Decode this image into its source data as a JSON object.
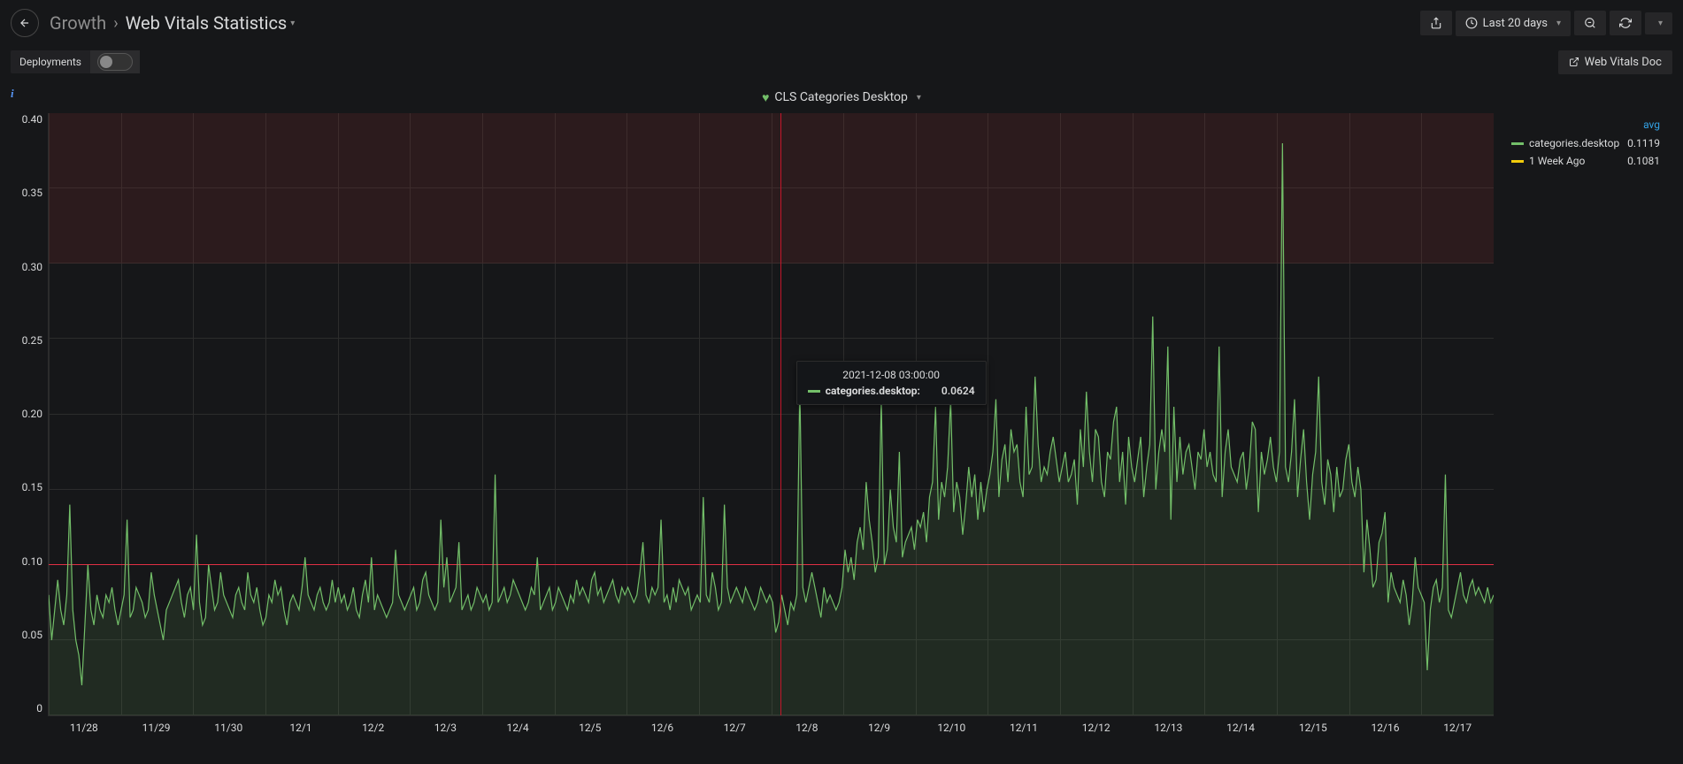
{
  "breadcrumb": {
    "root": "Growth",
    "leaf": "Web Vitals Statistics"
  },
  "toolbar": {
    "time_range": "Last 20 days",
    "doc_link": "Web Vitals Doc",
    "deployments_label": "Deployments"
  },
  "panel": {
    "title": "CLS Categories Desktop"
  },
  "tooltip": {
    "timestamp": "2021-12-08 03:00:00",
    "series_label": "categories.desktop:",
    "value": "0.0624"
  },
  "legend": {
    "header": "avg",
    "rows": [
      {
        "label": "categories.desktop",
        "value": "0.1119",
        "color": "sw-green"
      },
      {
        "label": "1 Week Ago",
        "value": "0.1081",
        "color": "sw-yellow"
      }
    ]
  },
  "chart_data": {
    "type": "line",
    "title": "CLS Categories Desktop",
    "xlabel": "",
    "ylabel": "",
    "ylim": [
      0,
      0.4
    ],
    "y_ticks": [
      0.4,
      0.35,
      0.3,
      0.25,
      0.2,
      0.15,
      0.1,
      0.05,
      0
    ],
    "threshold": 0.1,
    "cursor_x": "12/8 03:00",
    "x_ticks": [
      "11/28",
      "11/29",
      "11/30",
      "12/1",
      "12/2",
      "12/3",
      "12/4",
      "12/5",
      "12/6",
      "12/7",
      "12/8",
      "12/9",
      "12/10",
      "12/11",
      "12/12",
      "12/13",
      "12/14",
      "12/15",
      "12/16",
      "12/17"
    ],
    "series": [
      {
        "name": "categories.desktop",
        "color": "#73bf69",
        "avg": 0.1119,
        "values": [
          0.08,
          0.05,
          0.07,
          0.09,
          0.07,
          0.06,
          0.08,
          0.14,
          0.07,
          0.05,
          0.04,
          0.02,
          0.06,
          0.1,
          0.07,
          0.06,
          0.08,
          0.07,
          0.065,
          0.08,
          0.075,
          0.085,
          0.07,
          0.06,
          0.07,
          0.08,
          0.13,
          0.065,
          0.07,
          0.085,
          0.08,
          0.075,
          0.065,
          0.07,
          0.095,
          0.08,
          0.07,
          0.06,
          0.05,
          0.07,
          0.075,
          0.08,
          0.085,
          0.09,
          0.075,
          0.065,
          0.08,
          0.085,
          0.07,
          0.12,
          0.075,
          0.06,
          0.065,
          0.1,
          0.085,
          0.07,
          0.075,
          0.095,
          0.08,
          0.075,
          0.07,
          0.065,
          0.08,
          0.085,
          0.075,
          0.07,
          0.095,
          0.08,
          0.075,
          0.085,
          0.07,
          0.06,
          0.065,
          0.08,
          0.075,
          0.09,
          0.08,
          0.085,
          0.07,
          0.06,
          0.075,
          0.08,
          0.075,
          0.07,
          0.085,
          0.105,
          0.08,
          0.075,
          0.07,
          0.08,
          0.085,
          0.075,
          0.07,
          0.075,
          0.09,
          0.075,
          0.085,
          0.075,
          0.08,
          0.07,
          0.075,
          0.085,
          0.07,
          0.065,
          0.08,
          0.09,
          0.075,
          0.105,
          0.07,
          0.08,
          0.075,
          0.07,
          0.065,
          0.07,
          0.075,
          0.11,
          0.08,
          0.075,
          0.07,
          0.075,
          0.08,
          0.085,
          0.07,
          0.075,
          0.09,
          0.095,
          0.08,
          0.075,
          0.07,
          0.075,
          0.13,
          0.085,
          0.105,
          0.075,
          0.08,
          0.085,
          0.115,
          0.07,
          0.075,
          0.08,
          0.07,
          0.075,
          0.085,
          0.08,
          0.075,
          0.08,
          0.07,
          0.075,
          0.16,
          0.075,
          0.08,
          0.085,
          0.075,
          0.08,
          0.09,
          0.085,
          0.08,
          0.075,
          0.07,
          0.075,
          0.085,
          0.08,
          0.105,
          0.07,
          0.075,
          0.08,
          0.085,
          0.07,
          0.075,
          0.085,
          0.08,
          0.075,
          0.07,
          0.08,
          0.075,
          0.09,
          0.08,
          0.085,
          0.08,
          0.075,
          0.09,
          0.095,
          0.08,
          0.085,
          0.075,
          0.08,
          0.085,
          0.09,
          0.08,
          0.075,
          0.085,
          0.08,
          0.085,
          0.08,
          0.075,
          0.08,
          0.095,
          0.115,
          0.08,
          0.075,
          0.085,
          0.08,
          0.085,
          0.13,
          0.075,
          0.08,
          0.07,
          0.085,
          0.075,
          0.09,
          0.085,
          0.08,
          0.085,
          0.07,
          0.075,
          0.08,
          0.075,
          0.145,
          0.08,
          0.075,
          0.095,
          0.085,
          0.07,
          0.075,
          0.14,
          0.085,
          0.075,
          0.08,
          0.085,
          0.08,
          0.075,
          0.085,
          0.08,
          0.075,
          0.07,
          0.075,
          0.085,
          0.08,
          0.075,
          0.08,
          0.075,
          0.055,
          0.062,
          0.08,
          0.07,
          0.06,
          0.075,
          0.07,
          0.08,
          0.22,
          0.085,
          0.075,
          0.085,
          0.095,
          0.085,
          0.075,
          0.065,
          0.085,
          0.075,
          0.08,
          0.075,
          0.07,
          0.075,
          0.085,
          0.11,
          0.095,
          0.105,
          0.09,
          0.115,
          0.125,
          0.11,
          0.155,
          0.13,
          0.115,
          0.095,
          0.105,
          0.21,
          0.1,
          0.11,
          0.15,
          0.125,
          0.115,
          0.175,
          0.105,
          0.115,
          0.12,
          0.125,
          0.11,
          0.13,
          0.125,
          0.135,
          0.115,
          0.145,
          0.155,
          0.205,
          0.13,
          0.155,
          0.145,
          0.165,
          0.21,
          0.135,
          0.155,
          0.145,
          0.12,
          0.14,
          0.165,
          0.145,
          0.16,
          0.13,
          0.155,
          0.135,
          0.15,
          0.16,
          0.175,
          0.21,
          0.145,
          0.17,
          0.18,
          0.155,
          0.19,
          0.175,
          0.18,
          0.155,
          0.145,
          0.205,
          0.16,
          0.165,
          0.225,
          0.18,
          0.155,
          0.165,
          0.16,
          0.175,
          0.185,
          0.17,
          0.155,
          0.165,
          0.175,
          0.155,
          0.16,
          0.17,
          0.14,
          0.19,
          0.165,
          0.215,
          0.175,
          0.155,
          0.19,
          0.185,
          0.155,
          0.145,
          0.175,
          0.17,
          0.195,
          0.205,
          0.155,
          0.175,
          0.14,
          0.185,
          0.165,
          0.155,
          0.17,
          0.185,
          0.145,
          0.165,
          0.18,
          0.265,
          0.15,
          0.175,
          0.19,
          0.175,
          0.245,
          0.13,
          0.205,
          0.155,
          0.185,
          0.16,
          0.175,
          0.18,
          0.165,
          0.15,
          0.175,
          0.17,
          0.19,
          0.165,
          0.175,
          0.16,
          0.155,
          0.245,
          0.145,
          0.175,
          0.19,
          0.165,
          0.16,
          0.155,
          0.17,
          0.175,
          0.15,
          0.165,
          0.195,
          0.19,
          0.135,
          0.175,
          0.16,
          0.17,
          0.185,
          0.165,
          0.155,
          0.175,
          0.38,
          0.165,
          0.155,
          0.175,
          0.21,
          0.145,
          0.17,
          0.19,
          0.155,
          0.13,
          0.16,
          0.175,
          0.225,
          0.155,
          0.14,
          0.17,
          0.16,
          0.135,
          0.165,
          0.145,
          0.15,
          0.17,
          0.18,
          0.155,
          0.145,
          0.165,
          0.15,
          0.095,
          0.13,
          0.11,
          0.085,
          0.09,
          0.115,
          0.121,
          0.135,
          0.075,
          0.095,
          0.085,
          0.08,
          0.075,
          0.09,
          0.08,
          0.06,
          0.075,
          0.105,
          0.085,
          0.08,
          0.075,
          0.03,
          0.07,
          0.085,
          0.09,
          0.075,
          0.085,
          0.16,
          0.07,
          0.065,
          0.075,
          0.085,
          0.095,
          0.08,
          0.075,
          0.085,
          0.09,
          0.08,
          0.085,
          0.08,
          0.075,
          0.085,
          0.075,
          0.08
        ]
      },
      {
        "name": "1 Week Ago",
        "color": "#f2cc0c",
        "avg": 0.1081,
        "values": []
      }
    ]
  }
}
